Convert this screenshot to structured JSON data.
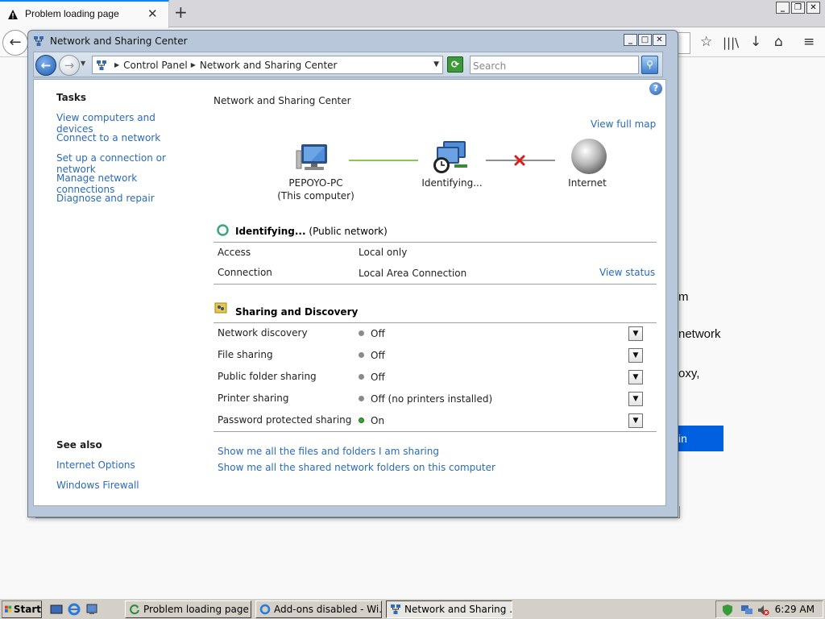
{
  "browser": {
    "tab_title": "Problem loading page",
    "page_fragments": [
      "m",
      "network",
      "oxy,",
      "in"
    ]
  },
  "window": {
    "title": "Network and Sharing Center",
    "min": "_",
    "max": "□",
    "close": "✕",
    "breadcrumb": [
      "Control Panel",
      "Network and Sharing Center"
    ],
    "search_placeholder": "Search",
    "help": "?"
  },
  "left_pane": {
    "tasks_heading": "Tasks",
    "tasks": [
      "View computers and devices",
      "Connect to a network",
      "Set up a connection or network",
      "Manage network connections",
      "Diagnose and repair"
    ],
    "see_also_heading": "See also",
    "see_also": [
      "Internet Options",
      "Windows Firewall"
    ]
  },
  "main": {
    "heading": "Network and Sharing Center",
    "view_full_map": "View full map",
    "map": {
      "computer_name": "PEPOYO-PC",
      "computer_sub": "(This computer)",
      "network_label": "Identifying...",
      "internet_label": "Internet"
    },
    "network": {
      "name": "Identifying...",
      "type": "(Public network)",
      "access_label": "Access",
      "access_value": "Local only",
      "connection_label": "Connection",
      "connection_value": "Local Area Connection",
      "view_status": "View status"
    },
    "sharing": {
      "heading": "Sharing and Discovery",
      "rows": [
        {
          "label": "Network discovery",
          "value": "Off",
          "on": false
        },
        {
          "label": "File sharing",
          "value": "Off",
          "on": false
        },
        {
          "label": "Public folder sharing",
          "value": "Off",
          "on": false
        },
        {
          "label": "Printer sharing",
          "value": "Off (no printers installed)",
          "on": false
        },
        {
          "label": "Password protected sharing",
          "value": "On",
          "on": true
        }
      ]
    },
    "links": [
      "Show me all the files and folders I am sharing",
      "Show me all the shared network folders on this computer"
    ]
  },
  "taskbar": {
    "start": "Start",
    "items": [
      "Problem loading page ...",
      "Add-ons disabled - Wi...",
      "Network and Sharing ..."
    ],
    "clock": "6:29 AM"
  },
  "colors": {
    "link": "#2a6ab7",
    "accent": "#0060df",
    "status_on": "#38a838",
    "disconnected": "#d42020"
  }
}
